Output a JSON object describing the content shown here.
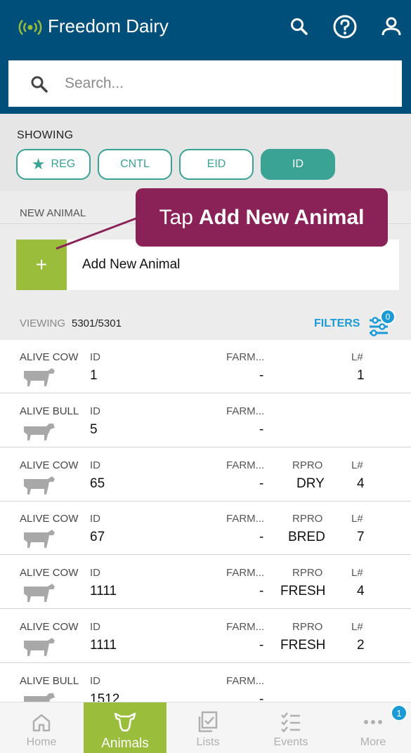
{
  "header": {
    "title": "Freedom Dairy",
    "search_placeholder": "Search..."
  },
  "showing": {
    "label": "SHOWING",
    "chips": [
      {
        "label": "REG",
        "active": false,
        "starred": true
      },
      {
        "label": "CNTL",
        "active": false
      },
      {
        "label": "EID",
        "active": false
      },
      {
        "label": "ID",
        "active": true
      }
    ]
  },
  "new_animal": {
    "section_label": "NEW ANIMAL",
    "add_label": "Add New Animal",
    "add_icon": "+"
  },
  "tooltip": {
    "prefix": "Tap",
    "emphasis": "Add New Animal"
  },
  "viewing": {
    "label": "VIEWING",
    "count": "5301/5301",
    "filters_label": "FILTERS",
    "filters_badge": "0"
  },
  "animals": [
    {
      "status": "ALIVE COW",
      "id_label": "ID",
      "id": "1",
      "farm_label": "FARM...",
      "farm": "-",
      "rpro_label": "",
      "rpro": "",
      "l_label": "L#",
      "l": "1",
      "type": "cow"
    },
    {
      "status": "ALIVE BULL",
      "id_label": "ID",
      "id": "5",
      "farm_label": "FARM...",
      "farm": "-",
      "rpro_label": "",
      "rpro": "",
      "l_label": "",
      "l": "",
      "type": "bull"
    },
    {
      "status": "ALIVE COW",
      "id_label": "ID",
      "id": "65",
      "farm_label": "FARM...",
      "farm": "-",
      "rpro_label": "RPRO",
      "rpro": "DRY",
      "l_label": "L#",
      "l": "4",
      "type": "cow"
    },
    {
      "status": "ALIVE COW",
      "id_label": "ID",
      "id": "67",
      "farm_label": "FARM...",
      "farm": "-",
      "rpro_label": "RPRO",
      "rpro": "BRED",
      "l_label": "L#",
      "l": "7",
      "type": "cow"
    },
    {
      "status": "ALIVE COW",
      "id_label": "ID",
      "id": "1111",
      "farm_label": "FARM...",
      "farm": "-",
      "rpro_label": "RPRO",
      "rpro": "FRESH",
      "l_label": "L#",
      "l": "4",
      "type": "cow"
    },
    {
      "status": "ALIVE COW",
      "id_label": "ID",
      "id": "1111",
      "farm_label": "FARM...",
      "farm": "-",
      "rpro_label": "RPRO",
      "rpro": "FRESH",
      "l_label": "L#",
      "l": "2",
      "type": "cow"
    },
    {
      "status": "ALIVE BULL",
      "id_label": "ID",
      "id": "1512",
      "farm_label": "FARM...",
      "farm": "-",
      "rpro_label": "",
      "rpro": "",
      "l_label": "",
      "l": "",
      "type": "bull"
    }
  ],
  "nav": {
    "items": [
      {
        "label": "Home",
        "icon": "home-icon",
        "active": false
      },
      {
        "label": "Animals",
        "icon": "cow-head-icon",
        "active": true
      },
      {
        "label": "Lists",
        "icon": "lists-icon",
        "active": false
      },
      {
        "label": "Events",
        "icon": "events-icon",
        "active": false
      },
      {
        "label": "More",
        "icon": "more-icon",
        "active": false
      }
    ],
    "more_badge": "1"
  },
  "colors": {
    "header": "#004f7a",
    "accent_teal": "#3aa394",
    "accent_green": "#9abd3c",
    "tooltip": "#8a2257",
    "link_blue": "#1a9ad6"
  }
}
